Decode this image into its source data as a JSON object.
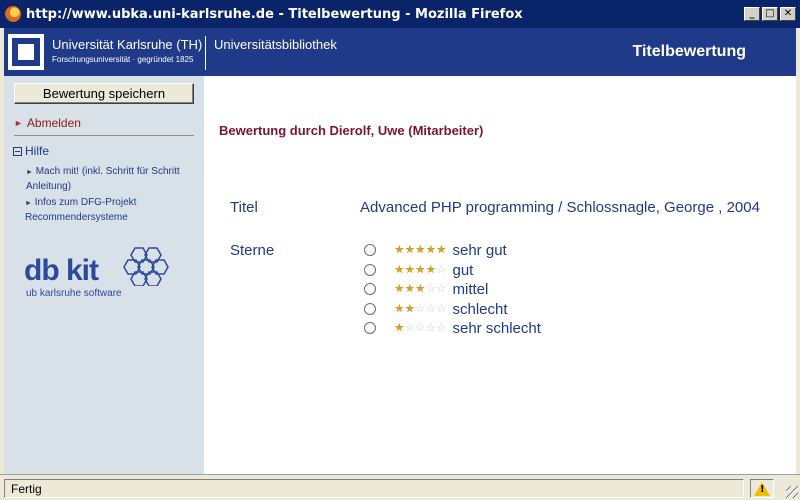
{
  "window": {
    "title": "http://www.ubka.uni-karlsruhe.de - Titelbewertung - Mozilla Firefox",
    "controls": {
      "minimize": "_",
      "maximize": "□",
      "close": "✕"
    }
  },
  "header": {
    "university": "Universität Karlsruhe (TH)",
    "university_sub": "Forschungsuniversität · gegründet 1825",
    "library": "Universitätsbibliothek",
    "page_heading": "Titelbewertung",
    "background_color": "#1f3a88"
  },
  "sidebar": {
    "save_button": "Bewertung speichern",
    "logout": "Abmelden",
    "help": "Hilfe",
    "help_items": [
      "Mach mit! (inkl. Schritt für Schritt Anleitung)",
      "Infos zum DFG-Projekt Recommendersysteme"
    ],
    "logo_text": "db kit",
    "logo_sub": "ub karlsruhe software"
  },
  "main": {
    "rating_title": "Bewertung durch Dierolf, Uwe (Mitarbeiter)",
    "title_label": "Titel",
    "title_value": "Advanced PHP programming / Schlossnagle, George , 2004",
    "stars_label": "Sterne",
    "options": [
      {
        "stars": 5,
        "label": "sehr gut"
      },
      {
        "stars": 4,
        "label": "gut"
      },
      {
        "stars": 3,
        "label": "mittel"
      },
      {
        "stars": 2,
        "label": "schlecht"
      },
      {
        "stars": 1,
        "label": "sehr schlecht"
      }
    ],
    "text_color": "#1f3a88",
    "heading_color": "#7a1530"
  },
  "statusbar": {
    "text": "Fertig"
  }
}
